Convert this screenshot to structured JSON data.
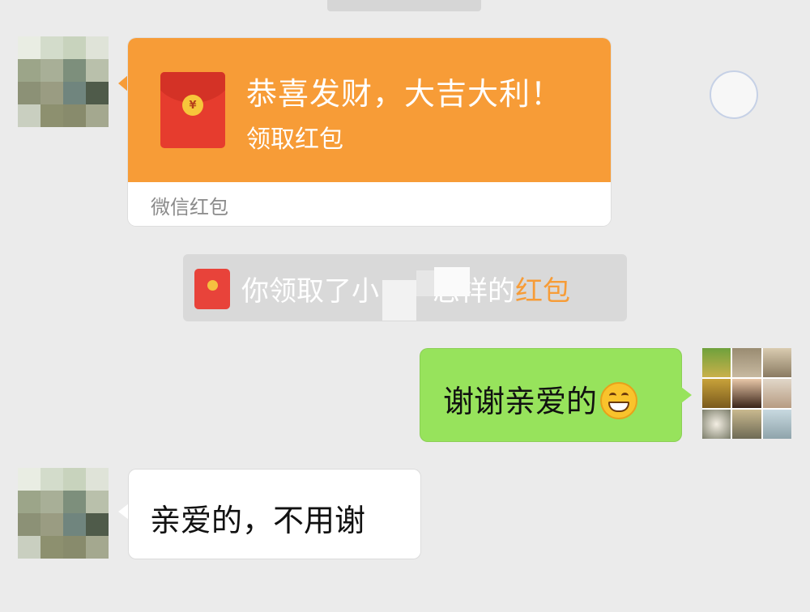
{
  "red_packet": {
    "title": "恭喜发财，大吉大利！",
    "action_label": "领取红包",
    "brand": "微信红包",
    "currency_symbol": "¥"
  },
  "notice": {
    "prefix": "你领取了小",
    "suffix": "志祥的",
    "link": "红包"
  },
  "messages": {
    "outgoing_text": "谢谢亲爱的",
    "outgoing_emoji": "grin-emoji",
    "incoming_text": "亲爱的，不用谢"
  },
  "colors": {
    "red_packet": "#f79c37",
    "outgoing_bubble": "#97e35c",
    "envelope": "#e63c2e",
    "background": "#ebebeb"
  }
}
